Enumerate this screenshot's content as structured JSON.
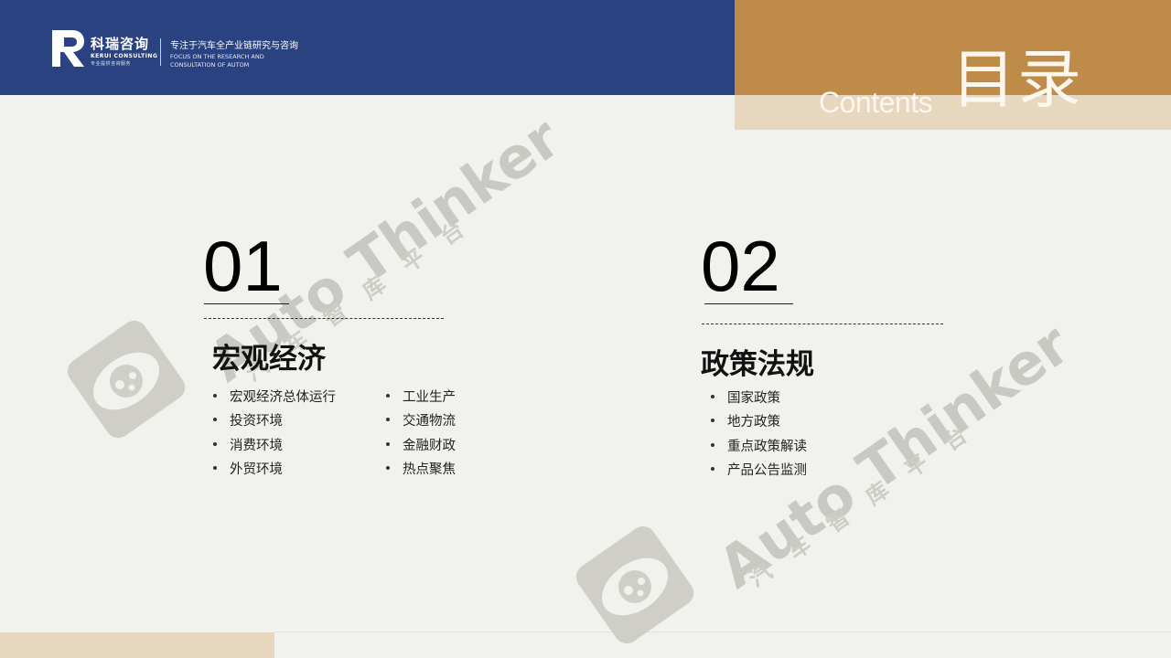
{
  "brand": {
    "name": "科瑞咨询",
    "name_en": "KERUI CONSULTING",
    "sub": "专业提供咨询服务",
    "tagline_cn": "专注于汽车全产业链研究与咨询",
    "tagline_en_line1": "FOCUS ON THE RESEARCH AND",
    "tagline_en_line2": "CONSULTATION OF AUTOM"
  },
  "contents": {
    "en": "Contents",
    "cn": "目录"
  },
  "watermark": {
    "text": "Auto Thinker",
    "cn": "汽车智库平台"
  },
  "sections": [
    {
      "number": "01",
      "title": "宏观经济",
      "items_col1": [
        "宏观经济总体运行",
        "投资环境",
        "消费环境",
        "外贸环境"
      ],
      "items_col2": [
        "工业生产",
        "交通物流",
        "金融财政",
        "热点聚焦"
      ]
    },
    {
      "number": "02",
      "title": "政策法规",
      "items_col1": [
        "国家政策",
        "地方政策",
        "重点政策解读",
        "产品公告监测"
      ]
    }
  ],
  "colors": {
    "header_blue": "#2a4280",
    "gold": "#bf8b48",
    "tan": "#e8d7bf",
    "background": "#f1f2ed",
    "watermark_gray": "#c9c9c3"
  },
  "icons": [
    "kerui-logo-icon",
    "watermark-eye-icon"
  ]
}
